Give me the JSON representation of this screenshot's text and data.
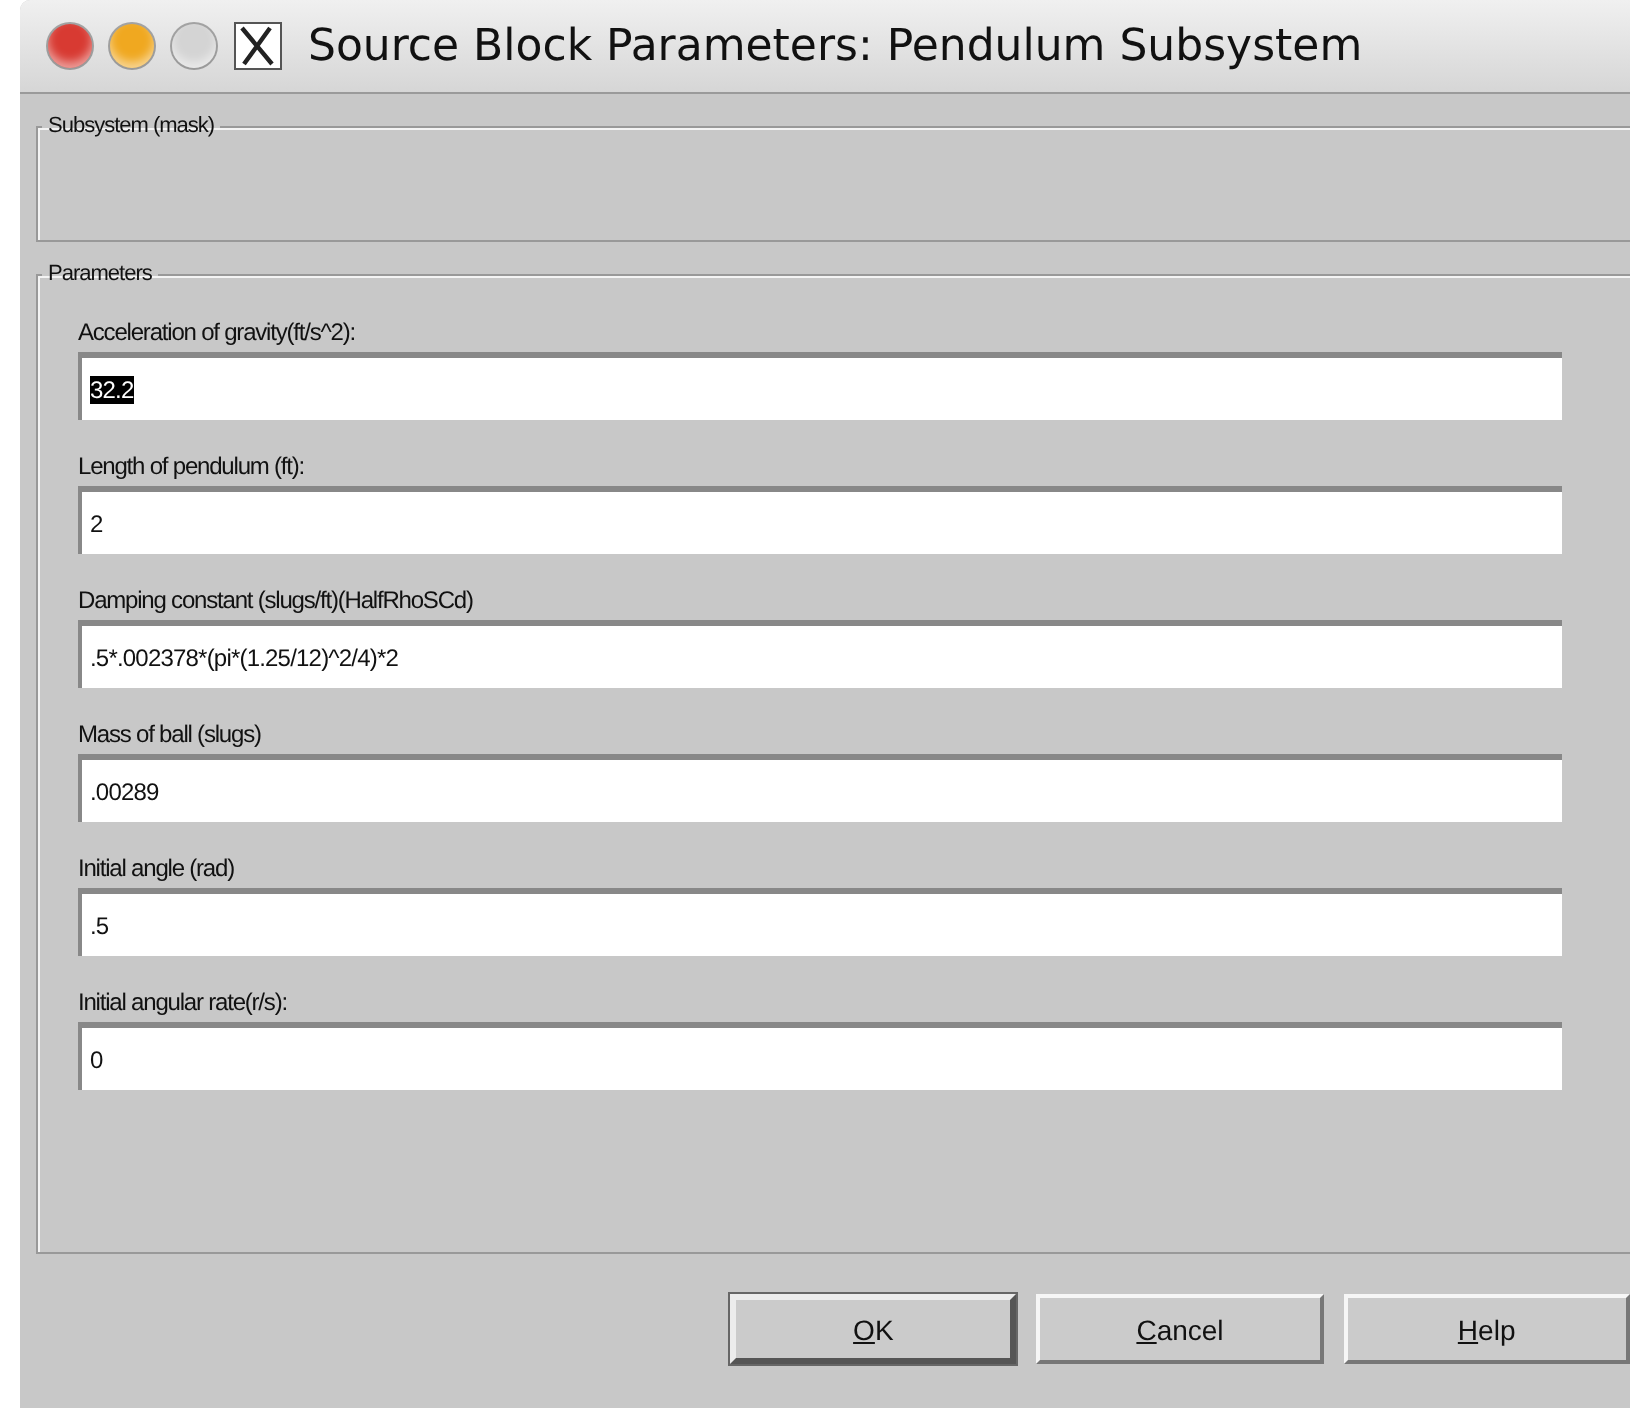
{
  "window": {
    "title": "Source Block Parameters: Pendulum Subsystem",
    "buttons": [
      {
        "kind": "close",
        "disabled": false
      },
      {
        "kind": "minimize",
        "disabled": false
      },
      {
        "kind": "zoom",
        "disabled": true
      }
    ]
  },
  "subsystem_group": {
    "title": "Subsystem (mask)"
  },
  "parameters_group": {
    "title": "Parameters",
    "fields": [
      {
        "label": "Acceleration of gravity(ft/s^2):",
        "value": "32.2",
        "selected": true
      },
      {
        "label": "Length of pendulum (ft):",
        "value": "2",
        "selected": false
      },
      {
        "label": "Damping constant (slugs/ft)(HalfRhoSCd)",
        "value": ".5*.002378*(pi*(1.25/12)^2/4)*2",
        "selected": false
      },
      {
        "label": "Mass of ball (slugs)",
        "value": ".00289",
        "selected": false
      },
      {
        "label": "Initial angle (rad)",
        "value": ".5",
        "selected": false
      },
      {
        "label": "Initial angular rate(r/s):",
        "value": "0",
        "selected": false
      }
    ]
  },
  "buttons": [
    {
      "label": "OK",
      "default": true
    },
    {
      "label": "Cancel",
      "default": false
    },
    {
      "label": "Help",
      "default": false
    }
  ]
}
